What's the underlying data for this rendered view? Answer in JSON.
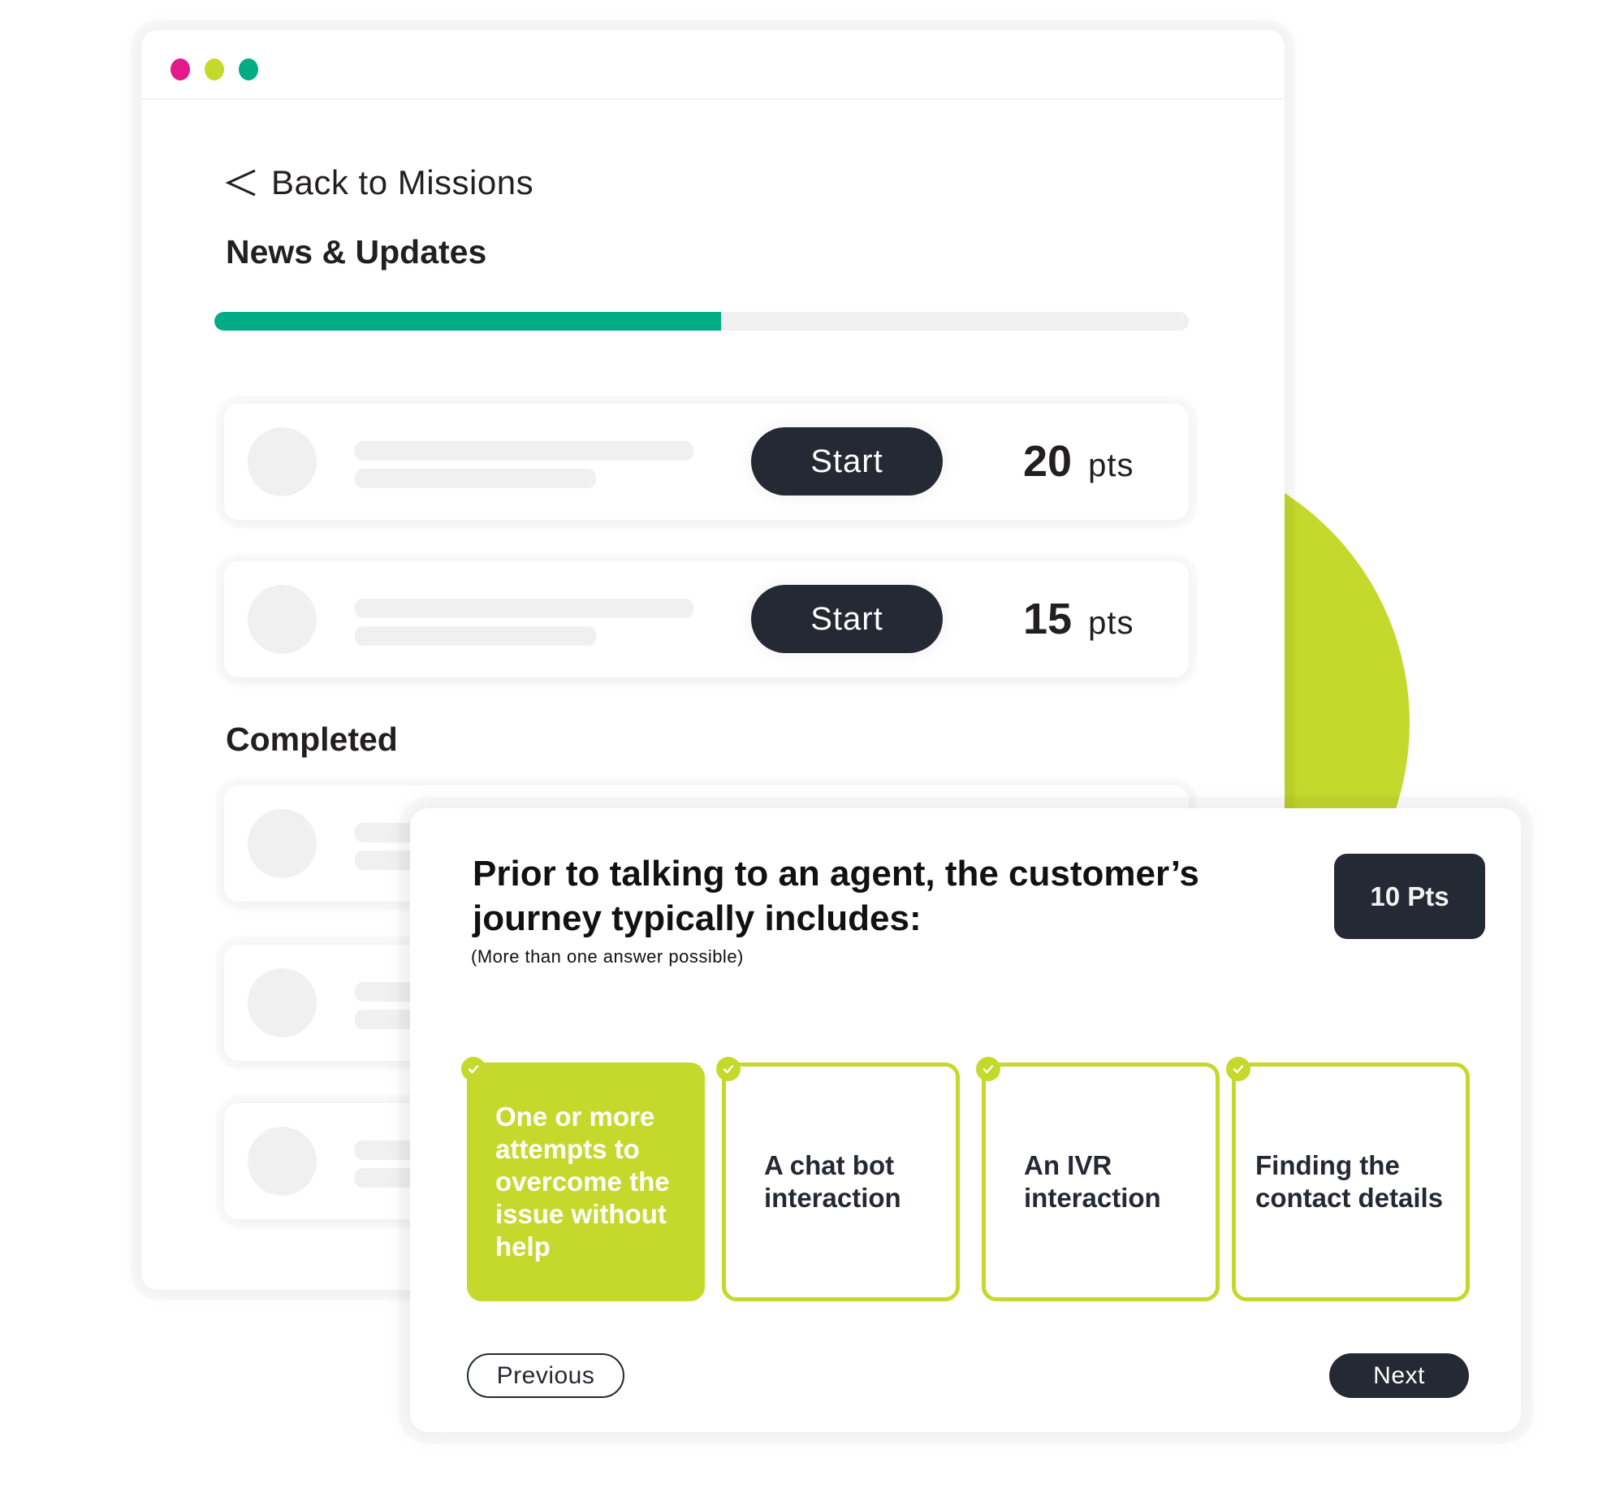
{
  "window": {
    "traffic_lights": [
      {
        "name": "close",
        "color": "#e4198b"
      },
      {
        "name": "minimize",
        "color": "#c5d92d"
      },
      {
        "name": "maximize",
        "color": "#00ac84"
      }
    ]
  },
  "nav": {
    "back_label": "Back to Missions",
    "back_icon": "chevron-left-icon"
  },
  "section": {
    "title": "News & Updates",
    "progress_percent": 52,
    "progress_color": "#00ac84"
  },
  "missions": [
    {
      "button_label": "Start",
      "points": "20",
      "points_unit": "pts"
    },
    {
      "button_label": "Start",
      "points": "15",
      "points_unit": "pts"
    }
  ],
  "completed": {
    "title": "Completed",
    "count_visible": 3
  },
  "quiz": {
    "question": "Prior to talking to an agent, the customer’s journey typically includes:",
    "hint": "(More than one answer possible)",
    "points_badge": "10 Pts",
    "options": [
      {
        "label": "One or more attempts to overcome the issue without help",
        "selected": true,
        "icon": "check-icon"
      },
      {
        "label": "A chat bot interaction",
        "selected": false,
        "icon": "check-icon"
      },
      {
        "label": "An IVR interaction",
        "selected": false,
        "icon": "check-icon"
      },
      {
        "label": "Finding the contact details",
        "selected": false,
        "icon": "check-icon"
      }
    ],
    "previous_label": "Previous",
    "next_label": "Next"
  },
  "colors": {
    "accent_lime": "#c5d92d",
    "accent_green": "#00ac84",
    "accent_pink": "#e4198b",
    "dark": "#242933",
    "placeholder_gray": "#f0f0f0"
  }
}
